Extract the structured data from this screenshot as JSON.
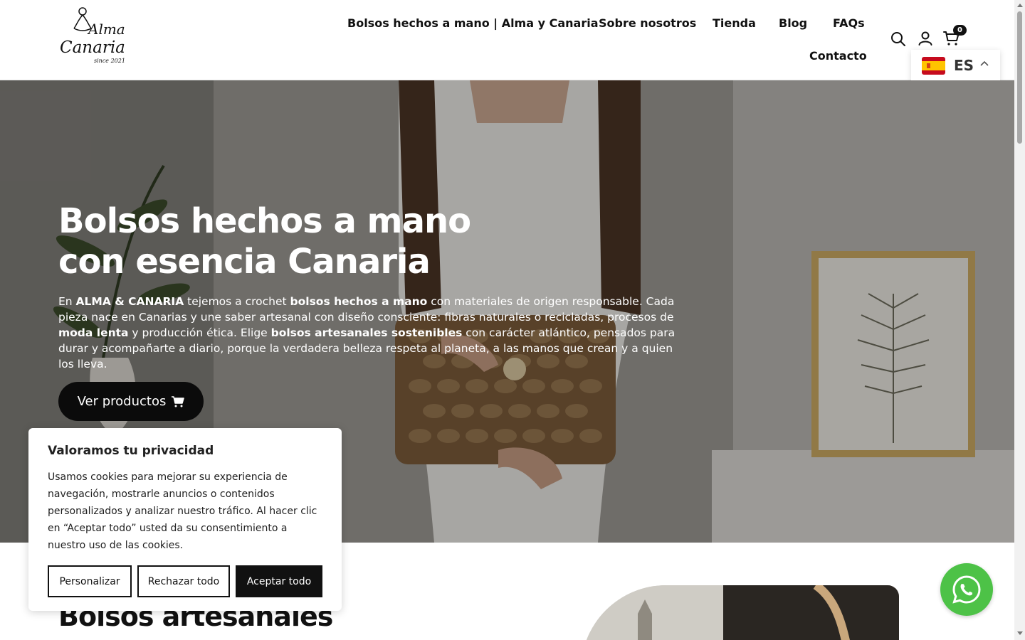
{
  "brand": {
    "logo_line1": "Alma",
    "logo_line2": "Canaria",
    "logo_line3": "since 2021"
  },
  "nav": {
    "items": [
      {
        "label": "Bolsos hechos a mano | Alma y Canaria"
      },
      {
        "label": "Sobre nosotros"
      },
      {
        "label": "Tienda"
      },
      {
        "label": "Blog"
      },
      {
        "label": "FAQs"
      },
      {
        "label": "Contacto"
      }
    ]
  },
  "header_icons": {
    "search": "search-icon",
    "account": "user-icon",
    "cart": "cart-icon",
    "cart_count": "0"
  },
  "language": {
    "code": "ES",
    "flag": "spain-flag-icon"
  },
  "hero": {
    "title_line1": "Bolsos hechos a mano",
    "title_line2": "con esencia Canaria",
    "text": {
      "p1": "En ",
      "b1": "ALMA & CANARIA",
      "p2": " tejemos a crochet ",
      "b2": "bolsos hechos a mano",
      "p3": " con materiales de origen responsable. Cada pieza nace en Canarias y une saber artesanal con diseño consciente: fibras naturales o recicladas, procesos de ",
      "b3": "moda lenta",
      "p4": " y producción ética. Elige ",
      "b4": "bolsos artesanales sostenibles",
      "p5": " con carácter atlántico, pensados para durar y acompañarte a diario, porque la verdadera belleza respeta al planeta, a las manos que crean y a quien los lleva."
    },
    "button_label": "Ver productos"
  },
  "section": {
    "title": "Bolsos artesanales"
  },
  "cookie": {
    "title": "Valoramos tu privacidad",
    "text": "Usamos cookies para mejorar su experiencia de navegación, mostrarle anuncios o contenidos personalizados y analizar nuestro tráfico. Al hacer clic en “Aceptar todo” usted da su consentimiento a nuestro uso de las cookies.",
    "customize": "Personalizar",
    "reject": "Rechazar todo",
    "accept": "Aceptar todo"
  },
  "colors": {
    "accent": "#111111",
    "whatsapp": "#4dc247"
  }
}
